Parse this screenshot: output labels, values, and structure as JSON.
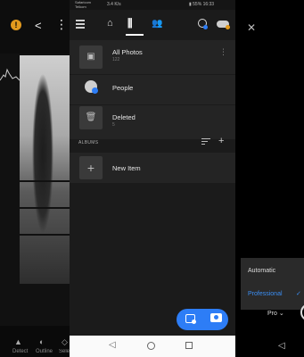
{
  "status_bar": {
    "carrier_line1": "Safaricom",
    "carrier_line2": "Telkom",
    "network": "3.4 K/s",
    "battery": "55%",
    "time": "16:33"
  },
  "header": {
    "icons": [
      "menu-icon",
      "home-icon",
      "library-icon",
      "people-icon",
      "search-icon",
      "cloud-sync-icon"
    ]
  },
  "library": {
    "items": [
      {
        "title": "All Photos",
        "count": "122",
        "icon": "image-icon"
      },
      {
        "title": "People",
        "count": "",
        "icon": "people-add-icon"
      },
      {
        "title": "Deleted",
        "count": "5",
        "icon": "trash-icon"
      }
    ],
    "more_glyph": "⋮"
  },
  "albums": {
    "section_label": "ALBUMS",
    "new_item_label": "New Item"
  },
  "left_app": {
    "bottom_labels": [
      "Detect",
      "Outline",
      "Selecti"
    ]
  },
  "right_app": {
    "modes": [
      "Automatic",
      "Professional"
    ],
    "selected_mode": "Professional",
    "pro_selector": "Pro ⌄"
  },
  "colors": {
    "accent": "#2d7df6",
    "warning": "#e39a1e",
    "background": "#1b1b1b",
    "row": "#242424"
  }
}
